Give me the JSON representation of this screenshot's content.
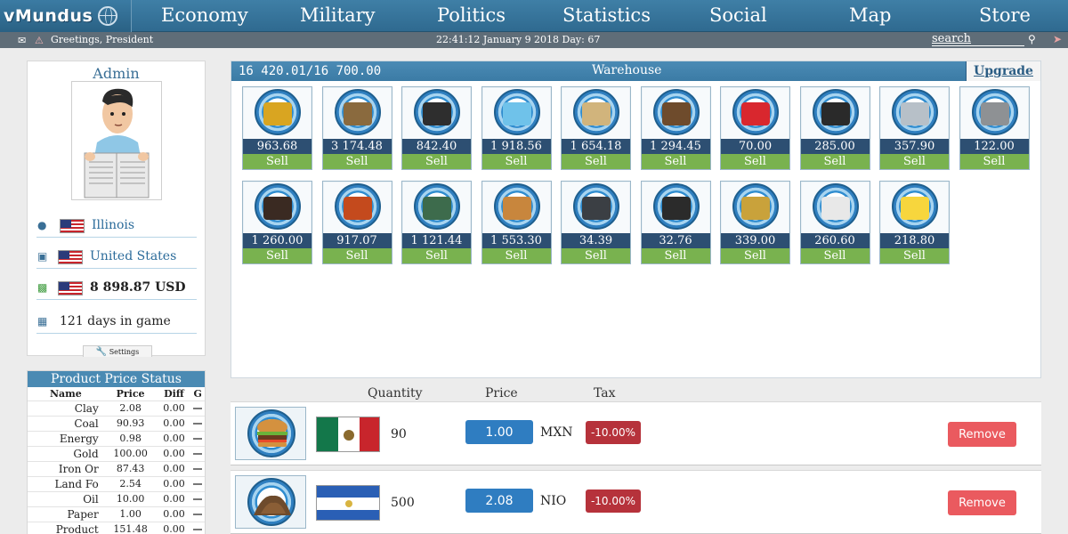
{
  "app": {
    "logo": "vMundus"
  },
  "nav": [
    "Economy",
    "Military",
    "Politics",
    "Statistics",
    "Social",
    "Map",
    "Store"
  ],
  "subbar": {
    "greeting": "Greetings, President",
    "datetime": "22:41:12 January 9 2018  Day: 67",
    "search_placeholder": "search",
    "icons": [
      "envelope-icon",
      "notification-icon",
      "search-icon",
      "sign-out-icon"
    ]
  },
  "profile": {
    "name": "Admin",
    "state": "Illinois",
    "country": "United States",
    "money": "8 898.87 USD",
    "days": "121 days in game",
    "settings_label": "Settings"
  },
  "price_status": {
    "title": "Product Price Status",
    "columns": [
      "Name",
      "Price",
      "Diff",
      "G"
    ],
    "rows": [
      {
        "name": "Clay",
        "price": "2.08",
        "diff": "0.00"
      },
      {
        "name": "Coal",
        "price": "90.93",
        "diff": "0.00"
      },
      {
        "name": "Energy",
        "price": "0.98",
        "diff": "0.00"
      },
      {
        "name": "Gold",
        "price": "100.00",
        "diff": "0.00"
      },
      {
        "name": "Iron Or",
        "price": "87.43",
        "diff": "0.00"
      },
      {
        "name": "Land Fo",
        "price": "2.54",
        "diff": "0.00"
      },
      {
        "name": "Oil",
        "price": "10.00",
        "diff": "0.00"
      },
      {
        "name": "Paper",
        "price": "1.00",
        "diff": "0.00"
      },
      {
        "name": "Product",
        "price": "151.48",
        "diff": "0.00"
      }
    ]
  },
  "warehouse": {
    "capacity": "16 420.01/16 700.00",
    "title": "Warehouse",
    "upgrade_label": "Upgrade",
    "sell_label": "Sell",
    "items": [
      {
        "icon": "gold-bar-icon",
        "amount": "963.68",
        "color": "#d9a521"
      },
      {
        "icon": "logs-icon",
        "amount": "3 174.48",
        "color": "#8a6a3e"
      },
      {
        "icon": "oil-barrel-icon",
        "amount": "842.40",
        "color": "#2e2e2e"
      },
      {
        "icon": "water-drop-icon",
        "amount": "1 918.56",
        "color": "#6fc2ea"
      },
      {
        "icon": "sand-pile-icon",
        "amount": "1 654.18",
        "color": "#d1b47c"
      },
      {
        "icon": "soil-pile-icon",
        "amount": "1 294.45",
        "color": "#6e4b2c"
      },
      {
        "icon": "gas-cylinder-icon",
        "amount": "70.00",
        "color": "#d9272e"
      },
      {
        "icon": "coal-pile-icon",
        "amount": "285.00",
        "color": "#2a2a2a"
      },
      {
        "icon": "steel-pipes-icon",
        "amount": "357.90",
        "color": "#b7c0c8"
      },
      {
        "icon": "stone-pile-icon",
        "amount": "122.00",
        "color": "#8e9194"
      },
      {
        "icon": "iron-ore-icon",
        "amount": "1 260.00",
        "color": "#3a2a22"
      },
      {
        "icon": "oil-rig-icon",
        "amount": "917.07",
        "color": "#c44a1d"
      },
      {
        "icon": "electronics-icon",
        "amount": "1 121.44",
        "color": "#3d6b4c"
      },
      {
        "icon": "burger-icon",
        "amount": "1 553.30",
        "color": "#c8863d"
      },
      {
        "icon": "body-armor-icon",
        "amount": "34.39",
        "color": "#3b3f44"
      },
      {
        "icon": "rifle-icon",
        "amount": "32.76",
        "color": "#2b2b2b"
      },
      {
        "icon": "ammo-icon",
        "amount": "339.00",
        "color": "#c9a23b"
      },
      {
        "icon": "paper-roll-icon",
        "amount": "260.60",
        "color": "#e8e8e8"
      },
      {
        "icon": "light-bulb-icon",
        "amount": "218.80",
        "color": "#f7d63d"
      }
    ]
  },
  "market": {
    "headers": {
      "quantity": "Quantity",
      "price": "Price",
      "tax": "Tax"
    },
    "remove_label": "Remove",
    "offers": [
      {
        "product_icon": "burger-icon",
        "country_flag": "mexico-flag-icon",
        "quantity": "90",
        "price": "1.00",
        "currency": "MXN",
        "tax": "-10.00%"
      },
      {
        "product_icon": "soil-pile-icon",
        "country_flag": "nicaragua-flag-icon",
        "quantity": "500",
        "price": "2.08",
        "currency": "NIO",
        "tax": "-10.00%"
      }
    ]
  },
  "colors": {
    "nav_blue": "#3f7fa6",
    "amount_navy": "#2d4f72",
    "sell_green": "#79b24f",
    "price_blue": "#2f7dc1",
    "tax_red": "#b6323b",
    "remove_red": "#ea5a5f"
  }
}
